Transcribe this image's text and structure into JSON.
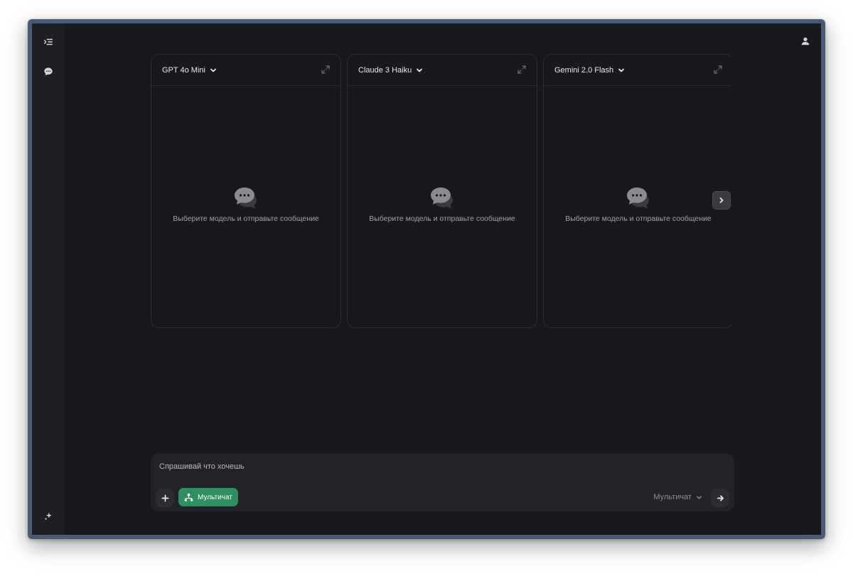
{
  "sidebar": {
    "items": [
      {
        "icon": "sidebar-toggle-icon"
      },
      {
        "icon": "chat-bubble-icon"
      },
      {
        "icon": "sparkle-icon"
      }
    ]
  },
  "header": {
    "user_icon": "user-icon"
  },
  "panels": [
    {
      "model": "GPT 4o Mini",
      "empty_text": "Выберите модель и отправьте сообщение"
    },
    {
      "model": "Claude 3 Haiku",
      "empty_text": "Выберите модель и отправьте сообщение"
    },
    {
      "model": "Gemini 2.0 Flash",
      "empty_text": "Выберите модель и отправьте сообщение"
    }
  ],
  "composer": {
    "placeholder": "Спрашивай что хочешь",
    "multichat_label": "Мультичат",
    "mode_label": "Мультичат"
  },
  "colors": {
    "background": "#18191d",
    "accent_green": "#2f8f5e",
    "frame": "#4a5a72"
  }
}
